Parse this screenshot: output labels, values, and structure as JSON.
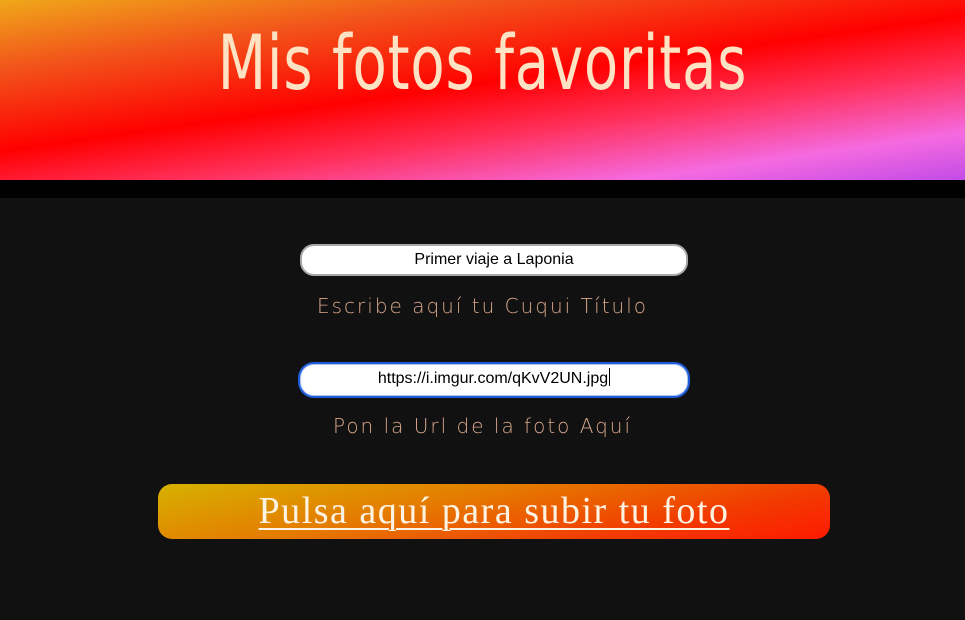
{
  "header": {
    "title": "Mis fotos favoritas"
  },
  "form": {
    "title_field": {
      "value": "Primer viaje a Laponia",
      "hint": "Escribe aquí tu Cuqui Título"
    },
    "url_field": {
      "value": "https://i.imgur.com/qKvV2UN.jpg",
      "hint": "Pon la Url de la foto Aquí"
    },
    "upload_button": {
      "label": "Pulsa aquí para subir tu foto"
    }
  },
  "colors": {
    "background": "#111111",
    "header_text": "#fde3c4",
    "hint_text": "#d9a88c",
    "focus_border": "#1f5ad9",
    "button_text": "#fdf3e3"
  }
}
